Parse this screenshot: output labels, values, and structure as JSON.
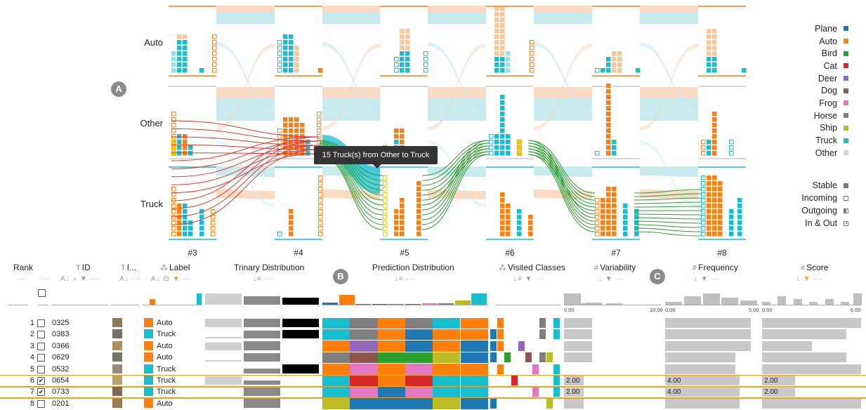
{
  "colors": {
    "Plane": "#1f77b4",
    "Auto": "#ff7f0e",
    "Bird": "#2ca02c",
    "Cat": "#d62728",
    "Deer": "#9467bd",
    "Dog": "#8c564b",
    "Frog": "#e377c2",
    "Horse": "#7f7f7f",
    "Ship": "#bcbd22",
    "Truck": "#17becf",
    "Other": "#d4d4d4",
    "Incoming": "#f2c600"
  },
  "legend": {
    "classes": [
      "Plane",
      "Auto",
      "Bird",
      "Cat",
      "Deer",
      "Dog",
      "Frog",
      "Horse",
      "Ship",
      "Truck",
      "Other"
    ],
    "glyphs": [
      {
        "label": "Stable",
        "kind": "stable"
      },
      {
        "label": "Incoming",
        "kind": "incoming"
      },
      {
        "label": "Outgoing",
        "kind": "outgoing"
      },
      {
        "label": "In & Out",
        "kind": "inout"
      }
    ]
  },
  "flow": {
    "rows": [
      "Auto",
      "Other",
      "Truck"
    ],
    "epochs": [
      "#3",
      "#4",
      "#5",
      "#6",
      "#7",
      "#8"
    ],
    "markers": {
      "a": "A",
      "b": "B",
      "c": "C"
    },
    "tooltip": "15 Truck(s) from Other to Truck"
  },
  "table": {
    "headers": {
      "rank": "Rank",
      "id": "ID",
      "image": "I...",
      "label": "Label",
      "trinary": "Trinary Distribution",
      "prediction": "Prediction Distribution",
      "visited": "Visited Classes",
      "variability": "Variability",
      "frequency": "Frequency",
      "score": "Score"
    },
    "axis_ticks": {
      "variability_min": "0.00",
      "variability_max": "10.00",
      "frequency_min": "0.00",
      "frequency_max": "5.00",
      "score_min": "0.00",
      "score_max": "6.00"
    },
    "rows": [
      {
        "rank": "1",
        "checked": false,
        "id": "0325",
        "label": "Auto",
        "highlight": false,
        "trinary": [
          0.95,
          0.95,
          0.95
        ],
        "pred": [
          "Truck",
          "Horse",
          "Auto",
          "Horse",
          "Truck",
          "Auto"
        ],
        "visited": [
          "Auto",
          "Horse",
          "Truck"
        ],
        "variability": 0,
        "frequency": 0,
        "score": 0,
        "var_bar": 0.29,
        "freq_bar": 0.92,
        "score_bar": 1.0,
        "overlay": ""
      },
      {
        "rank": "2",
        "checked": false,
        "id": "0383",
        "label": "Truck",
        "highlight": false,
        "trinary": [
          0.2,
          0.9,
          0.95
        ],
        "pred": [
          "Truck",
          "Horse",
          "Auto",
          "Plane",
          "Auto",
          "Auto"
        ],
        "visited": [
          "Plane",
          "Auto",
          "Horse",
          "Truck"
        ],
        "variability": 0,
        "frequency": 0,
        "score": 0,
        "var_bar": 0.29,
        "freq_bar": 0.92,
        "score_bar": 0.85,
        "overlay": ""
      },
      {
        "rank": "3",
        "checked": false,
        "id": "0366",
        "label": "Auto",
        "highlight": false,
        "trinary": [
          0.85,
          0.95,
          0
        ],
        "pred": [
          "Auto",
          "Deer",
          "Auto",
          "Plane",
          "Auto",
          "Plane"
        ],
        "visited": [
          "Plane",
          "Auto",
          "Deer"
        ],
        "variability": 0,
        "frequency": 0,
        "score": 0,
        "var_bar": 0.29,
        "freq_bar": 0.92,
        "score_bar": 0.5,
        "overlay": ""
      },
      {
        "rank": "4",
        "checked": false,
        "id": "0629",
        "label": "Auto",
        "highlight": false,
        "trinary": [
          0.2,
          0.95,
          0
        ],
        "pred": [
          "Horse",
          "Dog",
          "Bird",
          "Bird",
          "Ship",
          "Plane"
        ],
        "visited": [
          "Plane",
          "Bird",
          "Dog",
          "Horse",
          "Ship"
        ],
        "variability": 0,
        "frequency": 0,
        "score": 0,
        "var_bar": 0.29,
        "freq_bar": 0.75,
        "score_bar": 0.85,
        "overlay": ""
      },
      {
        "rank": "5",
        "checked": false,
        "id": "0532",
        "label": "Truck",
        "highlight": false,
        "trinary": [
          0,
          0.5,
          0.95
        ],
        "pred": [
          "Auto",
          "Frog",
          "Auto",
          "Frog",
          "Auto",
          "Auto"
        ],
        "visited": [
          "Auto",
          "Frog",
          "Truck"
        ],
        "variability": 0,
        "frequency": 0,
        "score": 0,
        "var_bar": 0.0,
        "freq_bar": 0.75,
        "score_bar": 1.0,
        "overlay": ""
      },
      {
        "rank": "6",
        "checked": true,
        "id": "0654",
        "label": "Truck",
        "highlight": true,
        "trinary": [
          0.95,
          0.5,
          0
        ],
        "pred": [
          "Truck",
          "Cat",
          "Auto",
          "Cat",
          "Truck",
          "Truck"
        ],
        "visited": [
          "Cat",
          "Truck"
        ],
        "variability": 2,
        "frequency": 4,
        "score": 2,
        "var_bar": 0.2,
        "freq_bar": 0.8,
        "score_bar": 0.33,
        "overlay": "on"
      },
      {
        "rank": "7",
        "checked": true,
        "id": "0733",
        "label": "Truck",
        "highlight": true,
        "trinary": [
          0,
          0.95,
          0
        ],
        "pred": [
          "Truck",
          "Frog",
          "Plane",
          "Frog",
          "Truck",
          "Truck"
        ],
        "visited": [
          "Frog",
          "Truck"
        ],
        "variability": 2,
        "frequency": 4,
        "score": 2,
        "var_bar": 0.2,
        "freq_bar": 0.8,
        "score_bar": 0.33,
        "overlay": "on"
      },
      {
        "rank": "8",
        "checked": false,
        "id": "0201",
        "label": "Auto",
        "highlight": false,
        "trinary": [
          0,
          0.95,
          0
        ],
        "pred": [
          "Ship",
          "Plane",
          "Plane",
          "Plane",
          "Ship",
          "Plane"
        ],
        "visited": [
          "Plane",
          "Ship"
        ],
        "variability": 0,
        "frequency": 0,
        "score": 0,
        "var_bar": 0.2,
        "freq_bar": 0.8,
        "score_bar": 1.0,
        "overlay": ""
      }
    ],
    "overlay_values": {
      "variability": "2.00",
      "frequency": "4.00",
      "score": "2.00"
    }
  }
}
